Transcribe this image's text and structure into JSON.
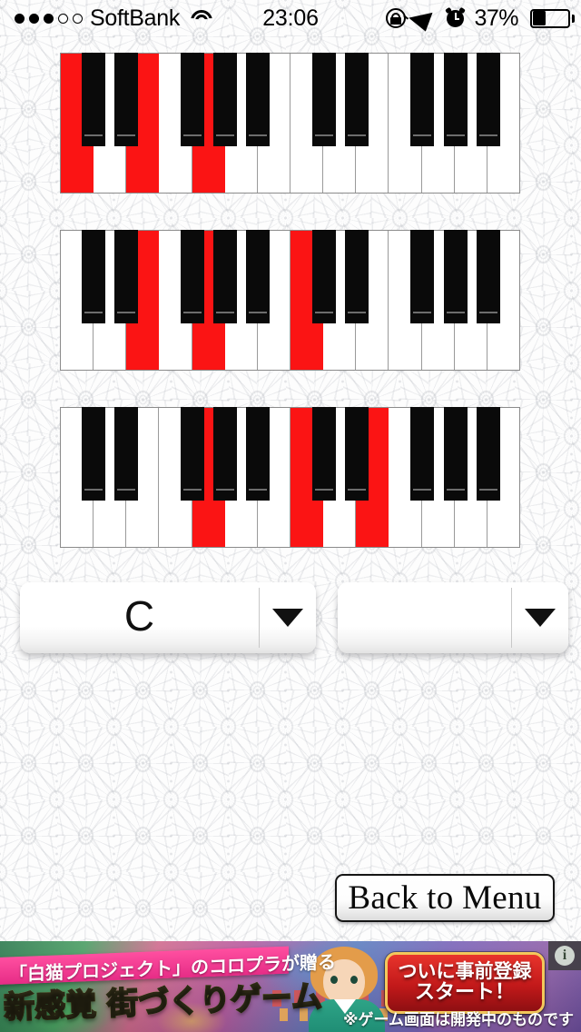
{
  "status_bar": {
    "signal_dots_filled": 3,
    "signal_dots_total": 5,
    "carrier": "SoftBank",
    "wifi_icon": "wifi-icon",
    "time": "23:06",
    "rotation_lock_icon": "rotation-lock-icon",
    "location_icon": "location-arrow-icon",
    "alarm_icon": "alarm-clock-icon",
    "battery_percent": "37%",
    "battery_level": 37
  },
  "keyboards": [
    {
      "name": "chord-voicing-root-position",
      "white_key_count": 14,
      "highlighted_white_keys": [
        1,
        3,
        5
      ],
      "black_key_positions": [
        1,
        2,
        4,
        5,
        6,
        8,
        9,
        11,
        12,
        13
      ],
      "highlighted_black_keys": []
    },
    {
      "name": "chord-voicing-first-inversion",
      "white_key_count": 14,
      "highlighted_white_keys": [
        3,
        5,
        8
      ],
      "black_key_positions": [
        1,
        2,
        4,
        5,
        6,
        8,
        9,
        11,
        12,
        13
      ],
      "highlighted_black_keys": []
    },
    {
      "name": "chord-voicing-second-inversion",
      "white_key_count": 14,
      "highlighted_white_keys": [
        5,
        8,
        10
      ],
      "black_key_positions": [
        1,
        2,
        4,
        5,
        6,
        8,
        9,
        11,
        12,
        13
      ],
      "highlighted_black_keys": []
    }
  ],
  "controls": {
    "root_select": {
      "value": "C",
      "caret_icon": "chevron-down-icon"
    },
    "quality_select": {
      "value": "",
      "caret_icon": "chevron-down-icon"
    },
    "back_button": "Back to Menu"
  },
  "ad": {
    "top_copy": "「白猫プロジェクト」のコロプラが贈る",
    "main_copy": "新感覚 街づくりゲーム",
    "cta_line1": "ついに事前登録",
    "cta_line2": "スタート！",
    "note": "※ゲーム画面は開発中のものです",
    "info_icon": "info-icon",
    "info_label": "i"
  },
  "colors": {
    "highlight_red": "#fb1414",
    "black_key": "#0a0a0a",
    "white_key": "#ffffff",
    "ad_pink": "#e62c86",
    "ad_red": "#c2191a"
  }
}
